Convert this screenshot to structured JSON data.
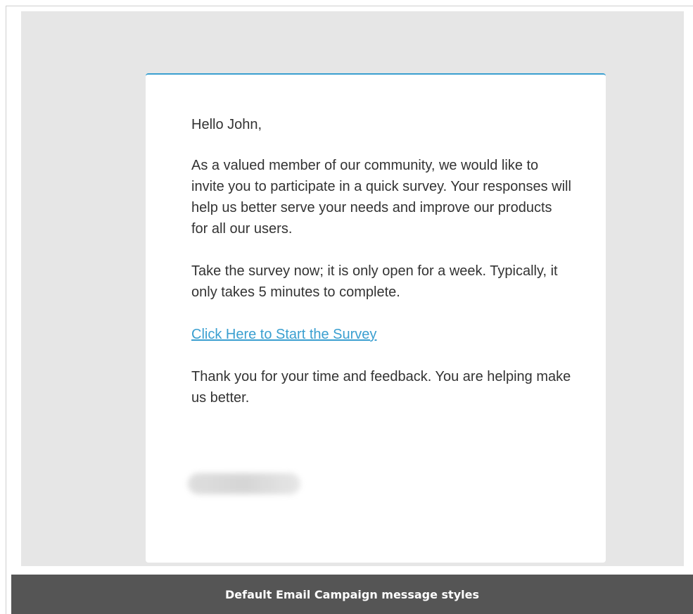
{
  "email": {
    "greeting": "Hello John,",
    "paragraph_1": "As a valued member of our community, we would like to invite you to participate in a quick survey. Your responses will help us better serve your needs and improve our products for all our users.",
    "paragraph_2": "Take the survey now; it is only open for a week. Typically, it only takes 5 minutes to complete.",
    "survey_link": "Click Here to Start the Survey",
    "paragraph_3": "Thank you for your time and feedback. You are helping make us better.",
    "accent_color": "#3a9fd0"
  },
  "caption": {
    "text": "Default Email Campaign message styles"
  }
}
